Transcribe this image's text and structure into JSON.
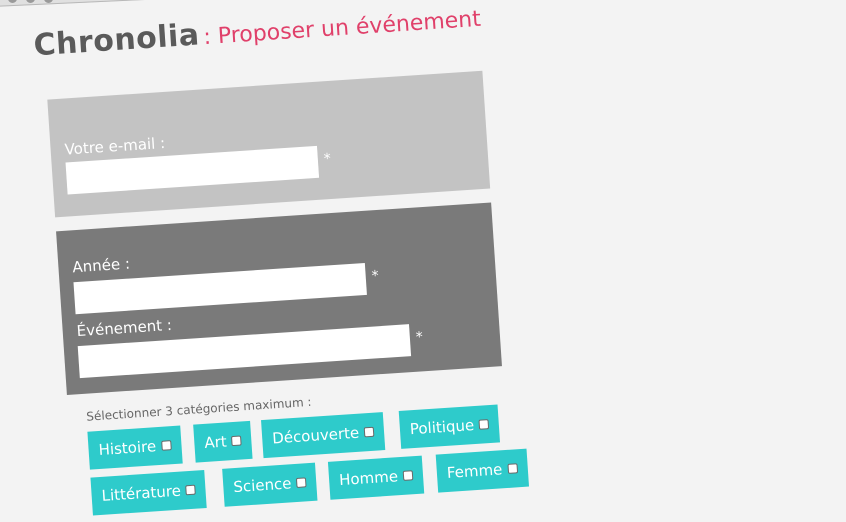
{
  "header": {
    "brand": "Chronolia",
    "tagline": ": Proposer un événement"
  },
  "form": {
    "email_label": "Votre e-mail :",
    "year_label": "Année :",
    "event_label": "Événement :",
    "required_marker": "*",
    "categories_label": "Sélectionner 3 catégories maximum :"
  },
  "categories": [
    {
      "label": "Histoire"
    },
    {
      "label": "Art"
    },
    {
      "label": "Découverte"
    },
    {
      "label": "Politique"
    },
    {
      "label": "Littérature"
    },
    {
      "label": "Science"
    },
    {
      "label": "Homme"
    },
    {
      "label": "Femme"
    }
  ],
  "colors": {
    "accent": "#e0406a",
    "category": "#2ecbcb",
    "panel_light": "#c3c3c3",
    "panel_dark": "#7a7a7a"
  }
}
